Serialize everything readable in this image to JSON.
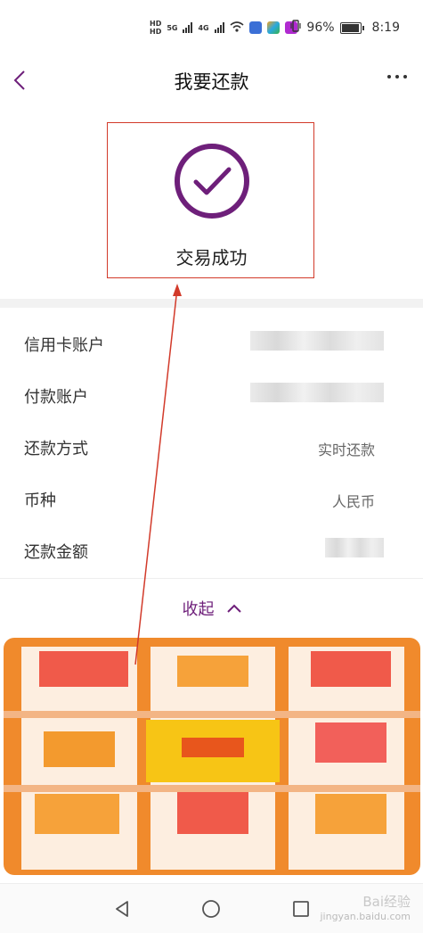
{
  "status_bar": {
    "battery_percent": "96%",
    "time": "8:19",
    "network_labels": [
      "HD",
      "5G",
      "4G"
    ]
  },
  "header": {
    "title": "我要还款"
  },
  "result": {
    "status_text": "交易成功",
    "accent_color": "#6e1f7a",
    "highlight_color": "#d23a2a"
  },
  "details": [
    {
      "label": "信用卡账户",
      "value": "",
      "masked": true
    },
    {
      "label": "付款账户",
      "value": "",
      "masked": true
    },
    {
      "label": "还款方式",
      "value": "实时还款",
      "masked": false
    },
    {
      "label": "币种",
      "value": "人民币",
      "masked": false
    },
    {
      "label": "还款金额",
      "value": "",
      "masked": true
    }
  ],
  "collapse": {
    "label": "收起"
  },
  "banner": {
    "icon": "pixelated-promo-banner"
  },
  "system_nav": {
    "icons": [
      "back-triangle-icon",
      "home-circle-icon",
      "recents-square-icon"
    ]
  },
  "watermark": {
    "line1": "Bai经验",
    "line2": "jingyan.baidu.com"
  }
}
